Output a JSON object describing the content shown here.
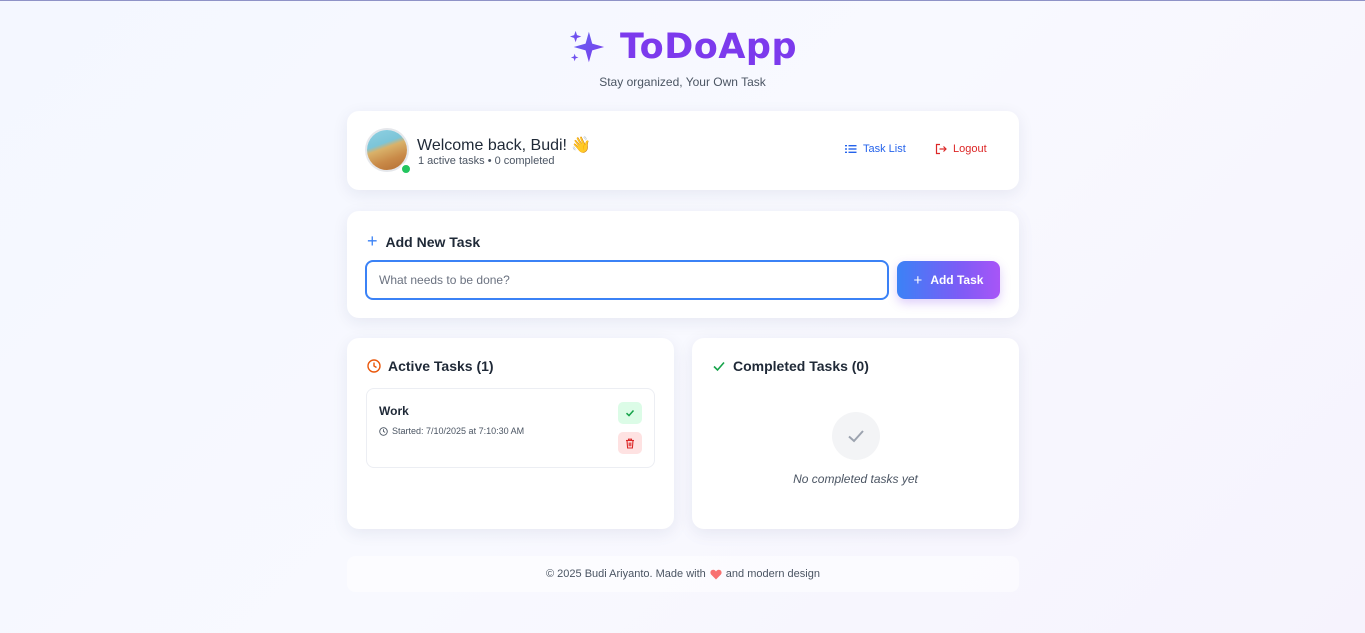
{
  "header": {
    "title": "ToDoApp",
    "subtitle": "Stay organized, Your Own Task",
    "icon": "sparkles-icon",
    "accent_color": "#7c3aed"
  },
  "user": {
    "welcome": "Welcome back, Budi!",
    "wave_emoji": "👋",
    "stats": "1 active tasks • 0 completed",
    "online_color": "#22c55e"
  },
  "nav": {
    "task_list_label": "Task List",
    "logout_label": "Logout"
  },
  "add_task": {
    "heading": "Add New Task",
    "placeholder": "What needs to be done?",
    "value": "",
    "button_label": "Add Task"
  },
  "active_tasks": {
    "heading": "Active Tasks (1)",
    "items": [
      {
        "name": "Work",
        "started": "Started: 7/10/2025 at 7:10:30 AM"
      }
    ]
  },
  "completed_tasks": {
    "heading": "Completed Tasks (0)",
    "empty_text": "No completed tasks yet"
  },
  "footer": {
    "prefix": "© 2025 Budi Ariyanto. Made with",
    "suffix": "and modern design",
    "heart_color": "#f87171"
  }
}
